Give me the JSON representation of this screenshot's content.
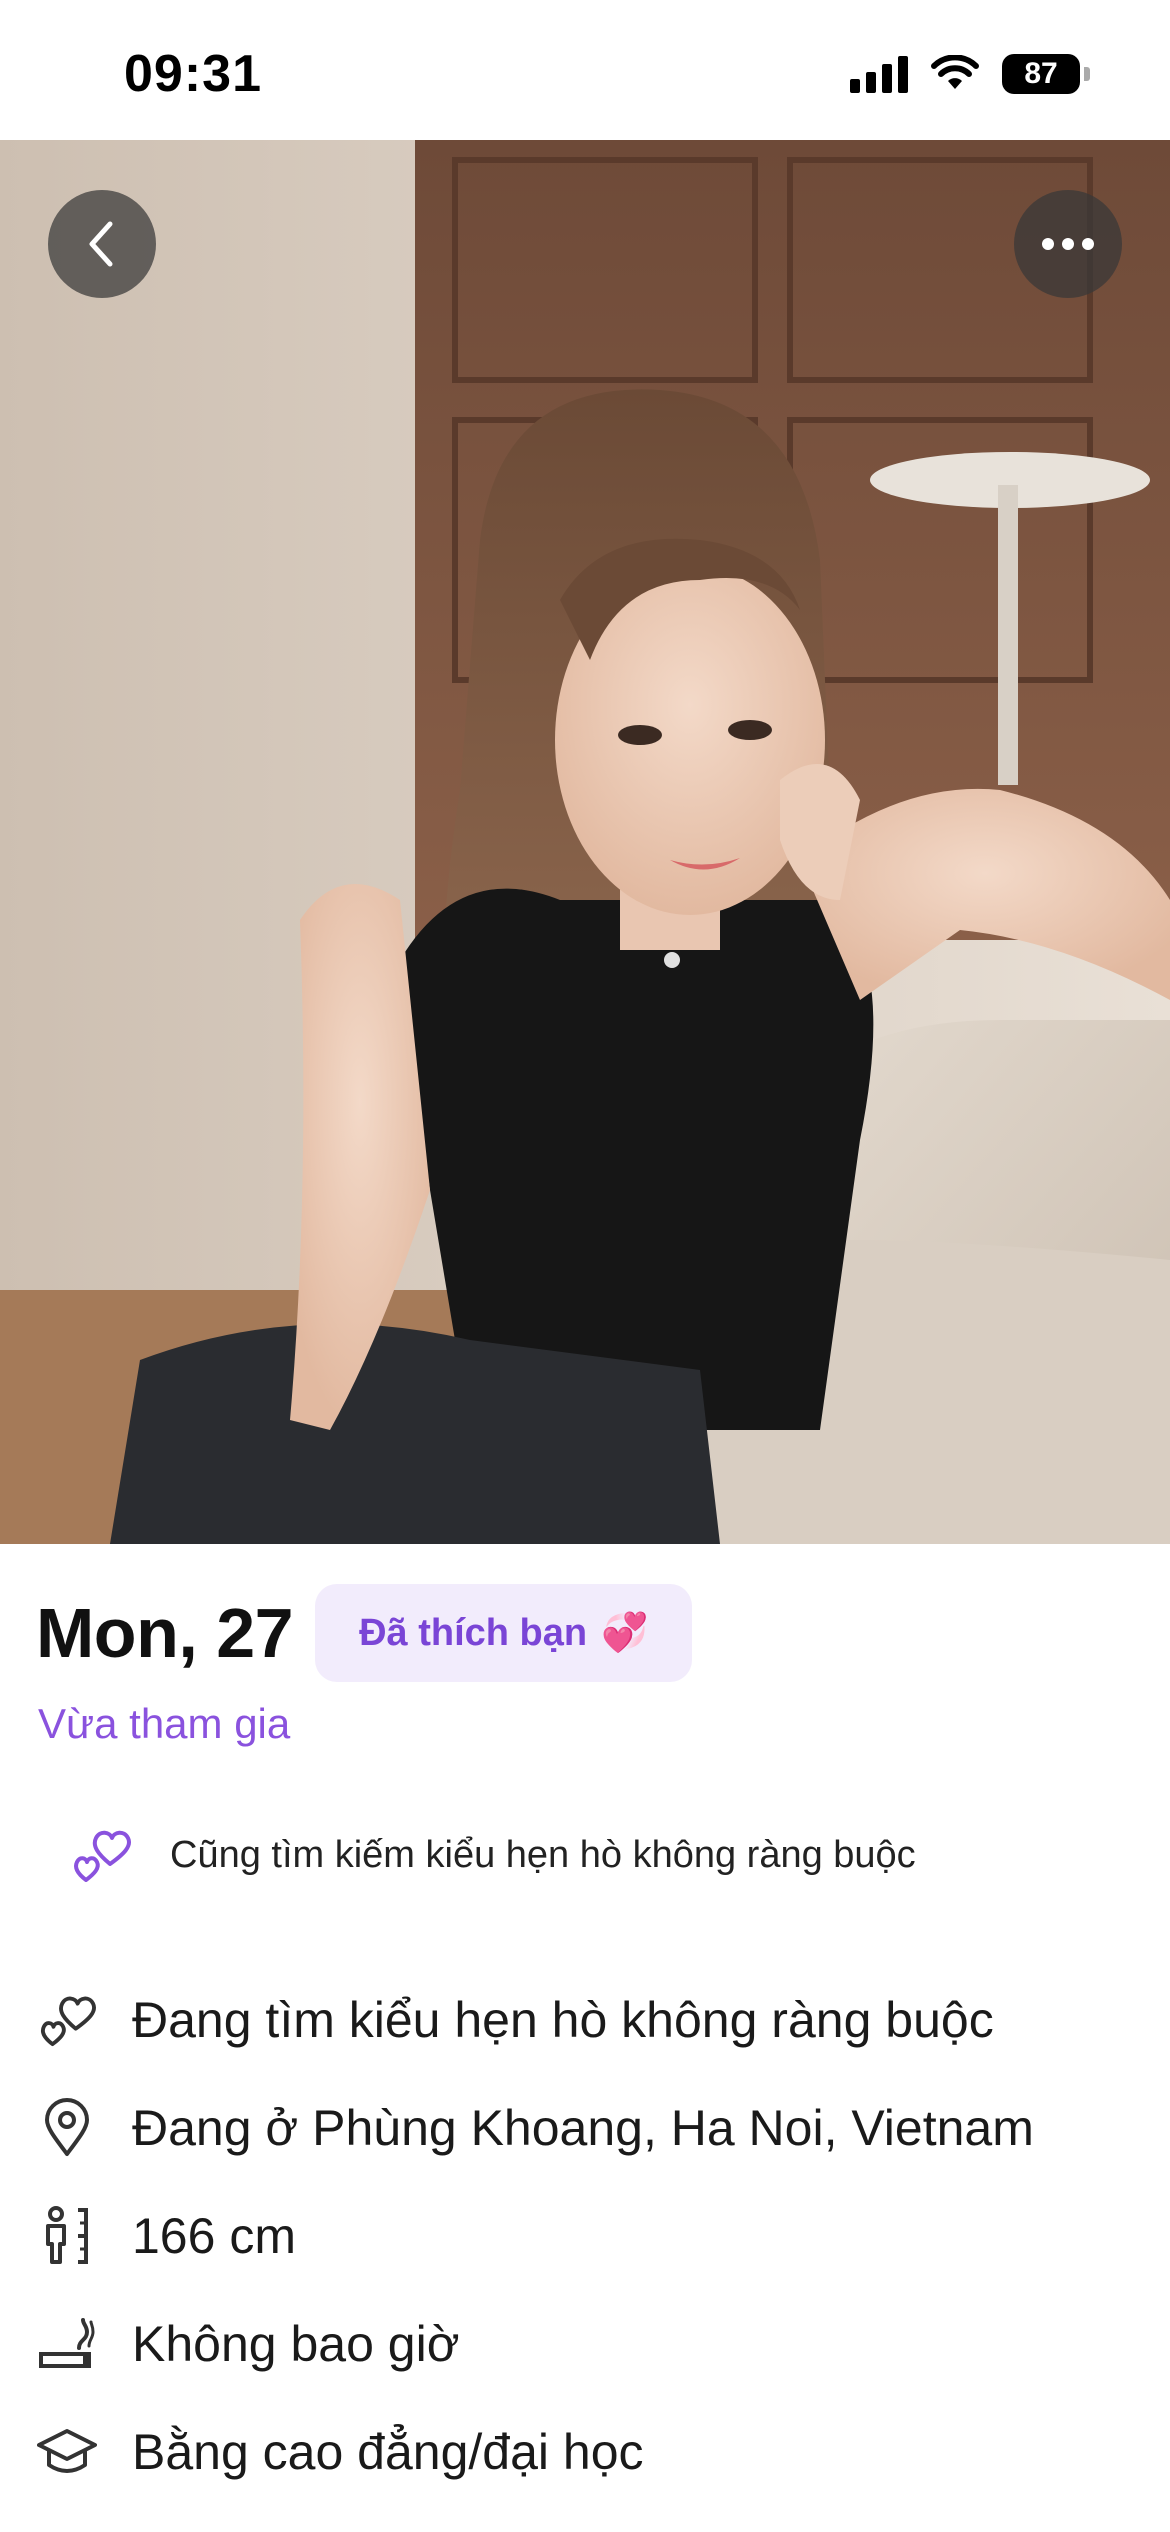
{
  "status_bar": {
    "time": "09:31",
    "battery": "87",
    "icons": [
      "signal-icon",
      "wifi-icon",
      "battery-icon"
    ]
  },
  "photo": {
    "description_icon": "profile-photo",
    "back_icon": "chevron-left-icon",
    "more_icon": "more-horizontal-icon"
  },
  "profile": {
    "name_age": "Mon, 27",
    "liked_badge": "Đã thích bạn",
    "liked_emoji": "💞",
    "joined": "Vừa tham gia"
  },
  "match": {
    "icon": "hearts-icon",
    "text": "Cũng tìm kiếm kiểu hẹn hò không ràng buộc"
  },
  "details": [
    {
      "icon": "hearts-outline-icon",
      "text": "Đang tìm kiểu hẹn hò không ràng buộc"
    },
    {
      "icon": "location-pin-icon",
      "text": "Đang ở Phùng Khoang, Ha Noi, Vietnam"
    },
    {
      "icon": "height-icon",
      "text": "166 cm"
    },
    {
      "icon": "smoking-icon",
      "text": "Không bao giờ"
    },
    {
      "icon": "graduation-cap-icon",
      "text": "Bằng cao đẳng/đại học"
    }
  ],
  "colors": {
    "accent": "#8a52de",
    "badge_bg": "#f2ecfc",
    "badge_text": "#7a45d6"
  }
}
